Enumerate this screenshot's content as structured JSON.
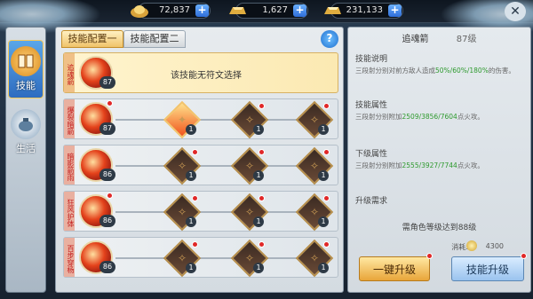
{
  "topbar": {
    "currencies": [
      {
        "value": "72,837",
        "icon": "ingot-icon"
      },
      {
        "value": "1,627",
        "icon": "gold-bar-icon"
      },
      {
        "value": "231,133",
        "icon": "silver-ingot-icon"
      }
    ],
    "settings_icon": "tools-icon"
  },
  "sidebar": {
    "items": [
      {
        "label": "技能",
        "icon": "book-icon",
        "active": true
      },
      {
        "label": "生活",
        "icon": "pot-icon",
        "active": false
      }
    ]
  },
  "tabs": [
    {
      "label": "技能配置一",
      "active": true
    },
    {
      "label": "技能配置二",
      "active": false
    }
  ],
  "help_label": "?",
  "skills": [
    {
      "name": "追魂箭",
      "level": "87",
      "selected": true,
      "message": "该技能无符文选择"
    },
    {
      "name": "爆裂暗箭",
      "level": "87",
      "selected": false,
      "runes": [
        "1",
        "1",
        "1"
      ]
    },
    {
      "name": "暗影箭雨",
      "level": "86",
      "selected": false,
      "runes": [
        "1",
        "1",
        "1"
      ]
    },
    {
      "name": "狂风护体",
      "level": "86",
      "selected": false,
      "runes": [
        "1",
        "1",
        "1"
      ]
    },
    {
      "name": "百步穿杨",
      "level": "86",
      "selected": false,
      "runes": [
        "1",
        "1",
        "1"
      ]
    }
  ],
  "detail": {
    "skill_name": "追魂箭",
    "skill_level": "87级",
    "desc_header": "技能说明",
    "desc_pre": "三段射分别对前方敌人造成",
    "desc_hl": "50%/60%/180%",
    "desc_post": "的伤害。",
    "attr_header": "技能属性",
    "attr_pre": "三段射分别附加",
    "attr_hl": "2509/3856/7604",
    "attr_post": "点火攻。",
    "next_header": "下级属性",
    "next_pre": "三段射分别附加",
    "next_hl": "2555/3927/7744",
    "next_post": "点火攻。",
    "req_header": "升级需求",
    "req_text": "需角色等级达到88级",
    "cost_label": "消耗:",
    "cost_value": "4300",
    "btn_one_click": "一键升级",
    "btn_upgrade": "技能升级"
  }
}
